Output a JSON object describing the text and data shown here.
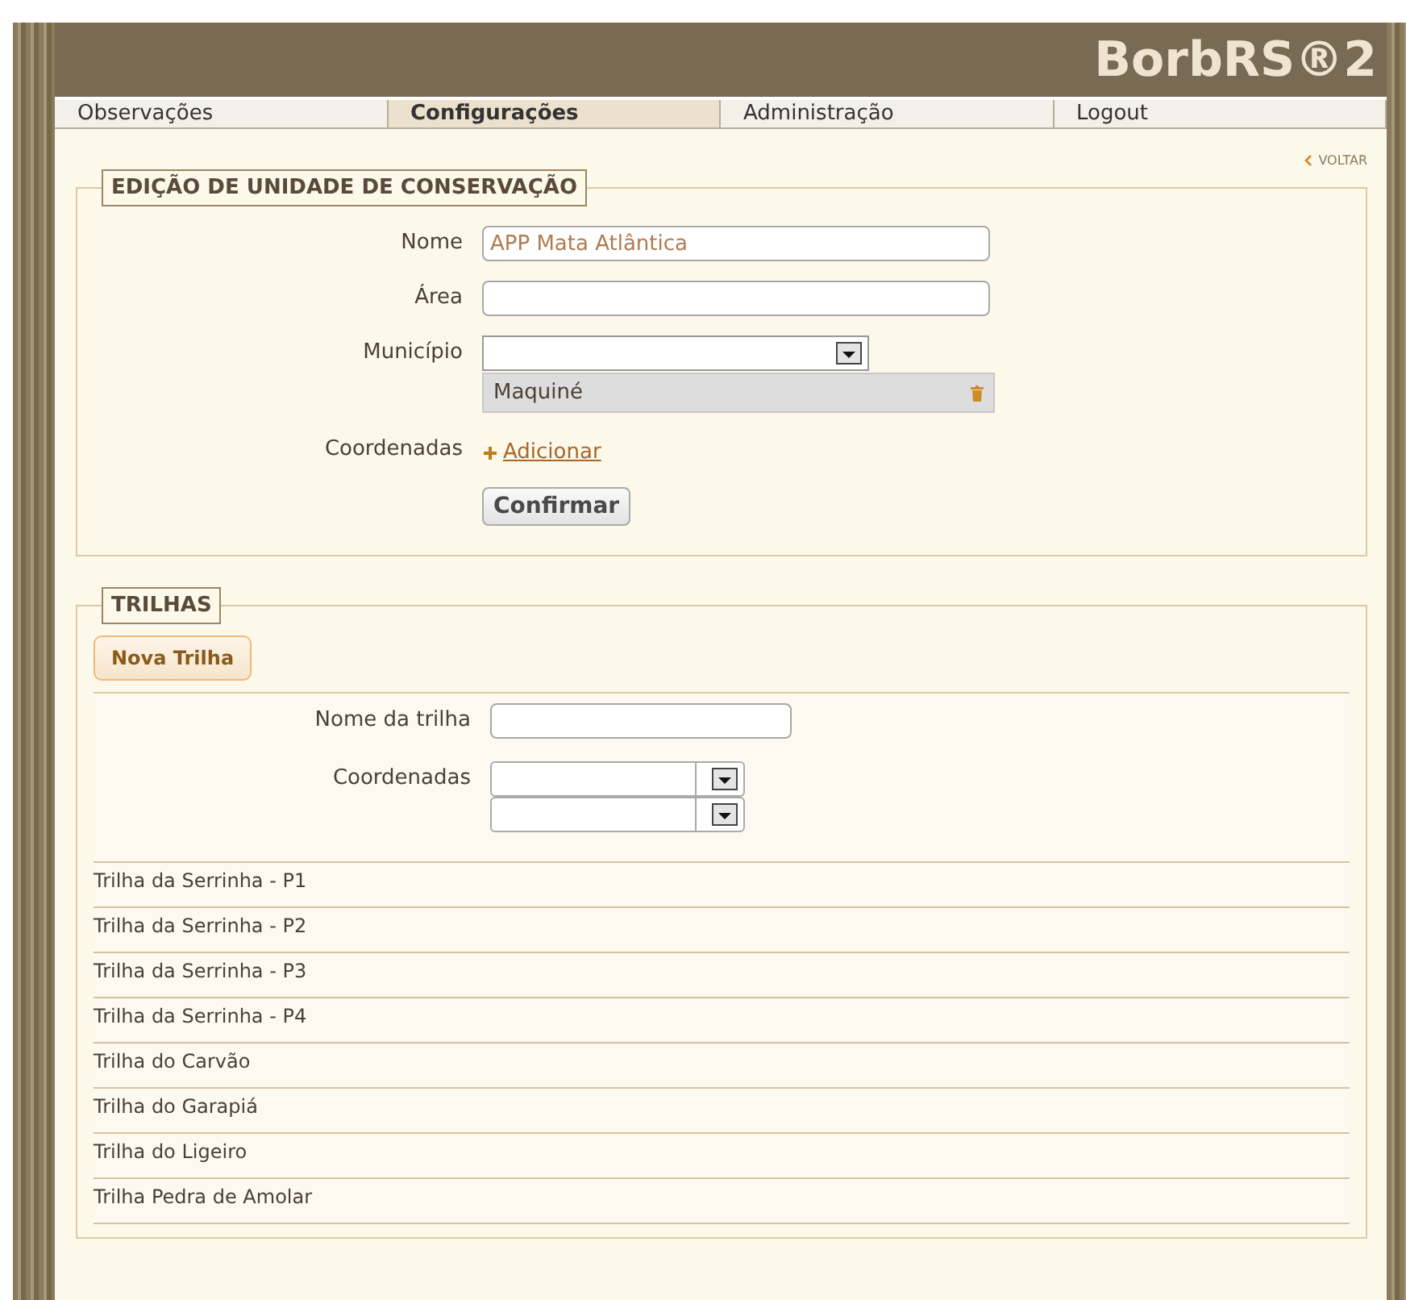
{
  "header": {
    "title": "BorbRS®2"
  },
  "tabs": [
    {
      "label": "Observações",
      "selected": false
    },
    {
      "label": "Configurações",
      "selected": true
    },
    {
      "label": "Administração",
      "selected": false
    },
    {
      "label": "Logout",
      "selected": false
    }
  ],
  "back_link": {
    "label": "VOLTAR"
  },
  "unit_form": {
    "legend": "EDIÇÃO DE UNIDADE DE CONSERVAÇÃO",
    "fields": [
      {
        "kind": "text",
        "label": "Nome",
        "value": "APP Mata Atlântica"
      },
      {
        "kind": "text",
        "label": "Área"
      },
      {
        "kind": "select",
        "label": "Município",
        "chips": [
          "Maquiné"
        ]
      },
      {
        "kind": "link",
        "label": "Coordenadas",
        "link": "Adicionar"
      }
    ],
    "submit": "Confirmar"
  },
  "trails": {
    "legend": "TRILHAS",
    "new_button": "Nova Trilha",
    "name_label": "Nome da trilha",
    "coords_label": "Coordenadas",
    "items": [
      "Trilha da Serrinha - P1",
      "Trilha da Serrinha - P2",
      "Trilha da Serrinha - P3",
      "Trilha da Serrinha - P4",
      "Trilha do Carvão",
      "Trilha do Garapiá",
      "Trilha do Ligeiro",
      "Trilha Pedra de Amolar"
    ]
  }
}
